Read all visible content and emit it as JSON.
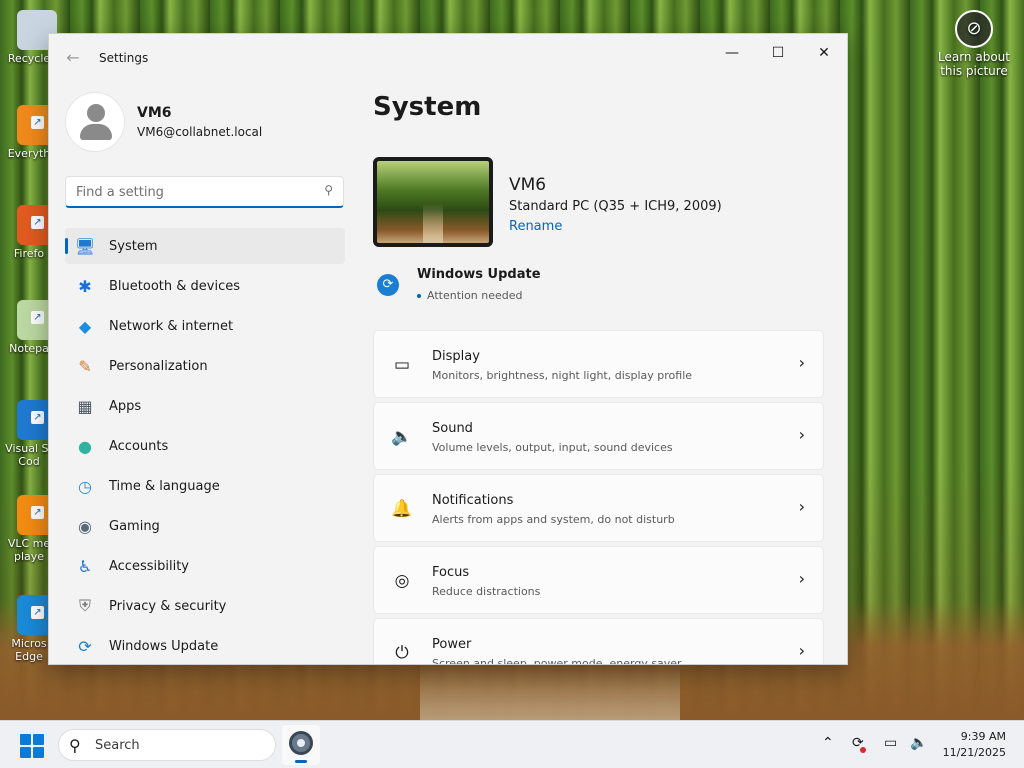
{
  "desktop": {
    "icons": [
      {
        "label": "Recycle",
        "name": "recycle-bin-icon",
        "color": "#c9d6e2"
      },
      {
        "label": "Everyth",
        "name": "everything-app-icon",
        "color": "#f08a1c"
      },
      {
        "label": "Firefo",
        "name": "firefox-icon",
        "color": "#e25b21"
      },
      {
        "label": "Notepa",
        "name": "notepad-icon",
        "color": "#bcd9a3"
      },
      {
        "label": "Visual St Cod",
        "name": "vscode-icon",
        "color": "#1f7ad1"
      },
      {
        "label": "VLC me playe",
        "name": "vlc-icon",
        "color": "#f28c13"
      },
      {
        "label": "Micros Edge",
        "name": "edge-icon",
        "color": "#1b8ad8"
      }
    ],
    "learn_label": "Learn about this picture"
  },
  "window": {
    "title": "Settings",
    "controls": {
      "minimize": "—",
      "maximize": "☐",
      "close": "✕"
    }
  },
  "profile": {
    "name": "VM6",
    "email": "VM6@collabnet.local"
  },
  "search": {
    "placeholder": "Find a setting"
  },
  "nav": [
    {
      "label": "System",
      "icon": "🖥",
      "name": "sidebar-item-system",
      "active": true
    },
    {
      "label": "Bluetooth & devices",
      "icon": "✱",
      "name": "sidebar-item-bluetooth"
    },
    {
      "label": "Network & internet",
      "icon": "◆",
      "name": "sidebar-item-network"
    },
    {
      "label": "Personalization",
      "icon": "✎",
      "name": "sidebar-item-personalization"
    },
    {
      "label": "Apps",
      "icon": "▦",
      "name": "sidebar-item-apps"
    },
    {
      "label": "Accounts",
      "icon": "●",
      "name": "sidebar-item-accounts"
    },
    {
      "label": "Time & language",
      "icon": "◷",
      "name": "sidebar-item-time-language"
    },
    {
      "label": "Gaming",
      "icon": "◉",
      "name": "sidebar-item-gaming"
    },
    {
      "label": "Accessibility",
      "icon": "♿",
      "name": "sidebar-item-accessibility"
    },
    {
      "label": "Privacy & security",
      "icon": "⛨",
      "name": "sidebar-item-privacy"
    },
    {
      "label": "Windows Update",
      "icon": "⟳",
      "name": "sidebar-item-windows-update"
    }
  ],
  "main": {
    "title": "System",
    "device": {
      "name": "VM6",
      "model": "Standard PC (Q35 + ICH9, 2009)",
      "rename": "Rename"
    },
    "windows_update": {
      "title": "Windows Update",
      "status": "Attention needed"
    },
    "cards": [
      {
        "title": "Display",
        "subtitle": "Monitors, brightness, night light, display profile",
        "icon": "▭",
        "name": "display-card"
      },
      {
        "title": "Sound",
        "subtitle": "Volume levels, output, input, sound devices",
        "icon": "🔈",
        "name": "sound-card"
      },
      {
        "title": "Notifications",
        "subtitle": "Alerts from apps and system, do not disturb",
        "icon": "🔔",
        "name": "notifications-card"
      },
      {
        "title": "Focus",
        "subtitle": "Reduce distractions",
        "icon": "◎",
        "name": "focus-card"
      },
      {
        "title": "Power",
        "subtitle": "Screen and sleep, power mode, energy saver",
        "icon": "⏻",
        "name": "power-card"
      }
    ]
  },
  "taskbar": {
    "search_label": "Search",
    "time": "9:39 AM",
    "date": "11/21/2025"
  },
  "colors": {
    "accent": "#0067c0",
    "window_bg": "#f3f3f3"
  }
}
